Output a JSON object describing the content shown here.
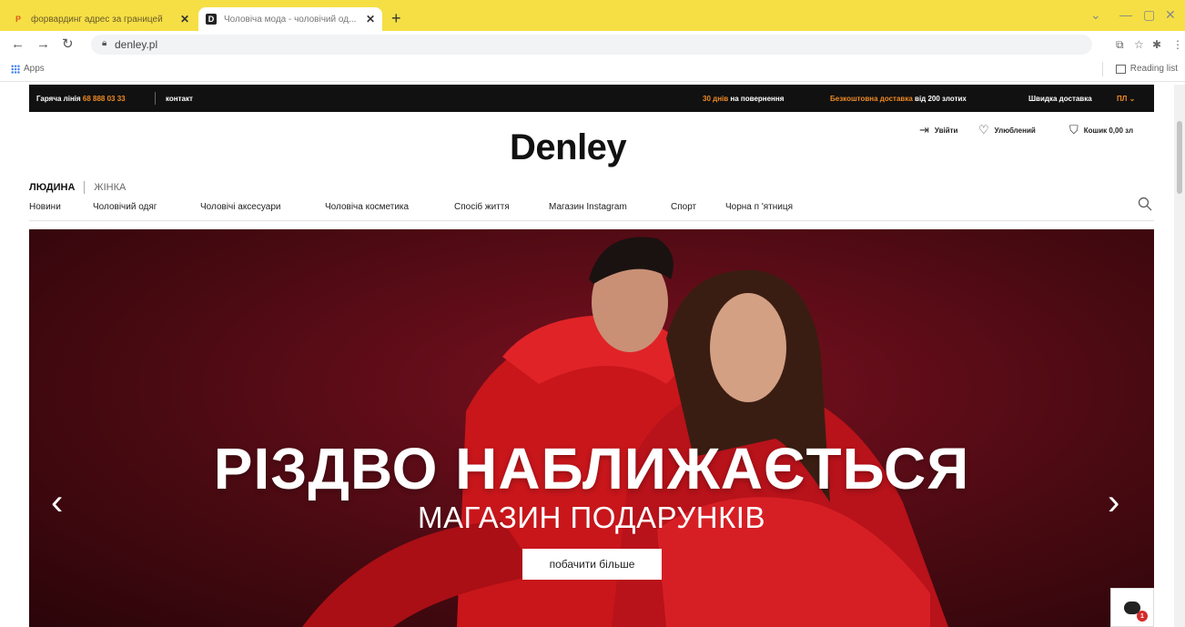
{
  "browser": {
    "tabs": [
      {
        "title": "форвардинг адрес за границей",
        "favicon": "P"
      },
      {
        "title": "Чоловіча мода - чоловічий од...",
        "favicon": "D"
      }
    ],
    "new_tab_label": "+",
    "url": "denley.pl",
    "bookmarks_apps": "Apps",
    "reading_list": "Reading list"
  },
  "topbar": {
    "hotline_label": "Гаряча лінія",
    "hotline_number": "68 888 03 33",
    "contact": "контакт",
    "returns_days": "30 днів",
    "returns_text": "на повернення",
    "free_delivery": "Безкоштовна доставка",
    "free_delivery_from": "від 200 злотих",
    "fast_delivery": "Швидка доставка",
    "language": "ПЛ"
  },
  "header": {
    "logo": "Denley",
    "login": "Увійти",
    "favorites": "Улюблений",
    "cart": "Кошик 0,00 зл"
  },
  "gender": {
    "men": "ЛЮДИНА",
    "women": "ЖІНКА"
  },
  "menu": [
    "Новини",
    "Чоловічий одяг",
    "Чоловічі аксесуари",
    "Чоловіча косметика",
    "Спосіб життя",
    "Магазин Instagram",
    "Спорт",
    "Чорна п 'ятниця"
  ],
  "hero": {
    "title": "РІЗДВО НАБЛИЖАЄТЬСЯ",
    "subtitle": "МАГАЗИН ПОДАРУНКІВ",
    "button": "побачити більше",
    "prev": "‹",
    "next": "›"
  },
  "chat": {
    "badge": "1"
  },
  "colors": {
    "accent": "#f08a24",
    "tabbar": "#f5df45",
    "hero_red": "#d41b1b"
  }
}
